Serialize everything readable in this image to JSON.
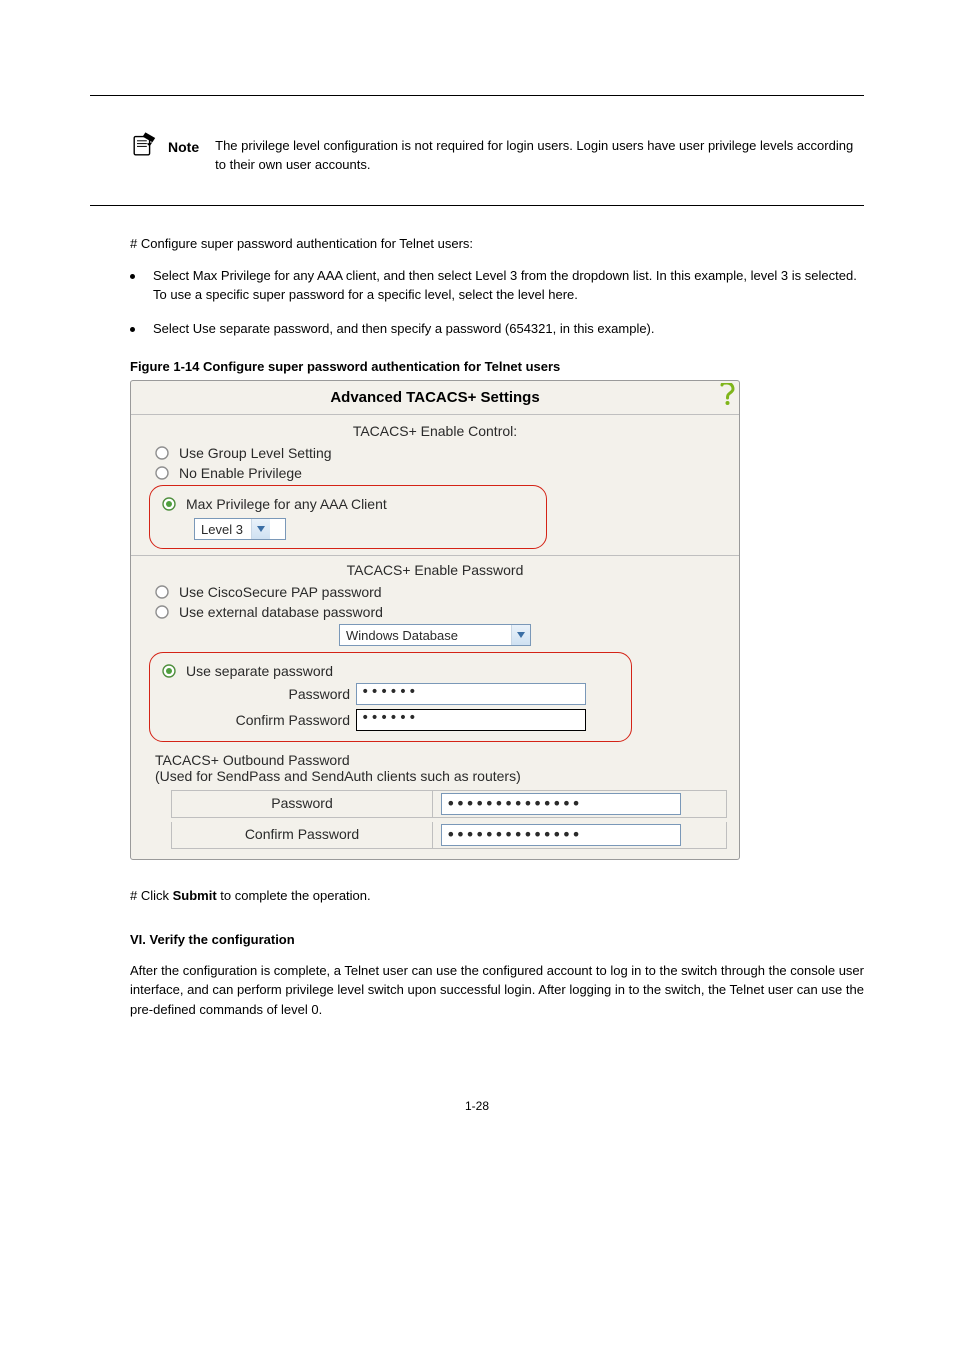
{
  "note": {
    "label": "Note",
    "text": "The privilege level configuration is not required for login users. Login users have user privilege levels according to their own user accounts."
  },
  "step7_heading": "# Configure super password authentication for Telnet users:",
  "step7_items": [
    "Select Max Privilege for any AAA client, and then select Level 3 from the dropdown list. In this example, level 3 is selected. To use a specific super password for a specific level, select the level here.",
    "Select Use separate password, and then specify a password (654321, in this example)."
  ],
  "figure_caption": "Figure 1-14 Configure super password authentication for Telnet users",
  "ui": {
    "header": "Advanced TACACS+ Settings",
    "enable_control": {
      "title": "TACACS+ Enable Control:",
      "opt1": "Use Group Level Setting",
      "opt2": "No Enable Privilege",
      "opt3": "Max Privilege for any AAA Client",
      "level": "Level 3"
    },
    "enable_password": {
      "title": "TACACS+ Enable Password",
      "opt1": "Use CiscoSecure PAP password",
      "opt2": "Use external database password",
      "db_select": "Windows Database",
      "opt3": "Use separate password",
      "pw_label": "Password",
      "pw_value": "••••••",
      "cpw_label": "Confirm Password",
      "cpw_value": "••••••"
    },
    "outbound": {
      "title": "TACACS+ Outbound Password",
      "subtitle": "(Used for SendPass and SendAuth clients such as routers)",
      "pw_label": "Password",
      "pw_value": "••••••••••••••",
      "cpw_label": "Confirm Password",
      "cpw_value": "••••••••••••••"
    }
  },
  "closing": {
    "p1_prefix": "# Click ",
    "p1_bold": "Submit",
    "p1_suffix": " to complete the operation.",
    "heading": "VI. Verify the configuration",
    "p2": "After the configuration is complete, a Telnet user can use the configured account to log in to the switch through the console user interface, and can perform privilege level switch upon successful login. After logging in to the switch, the Telnet user can use the pre-defined commands of level 0."
  },
  "page_number": "1-28"
}
